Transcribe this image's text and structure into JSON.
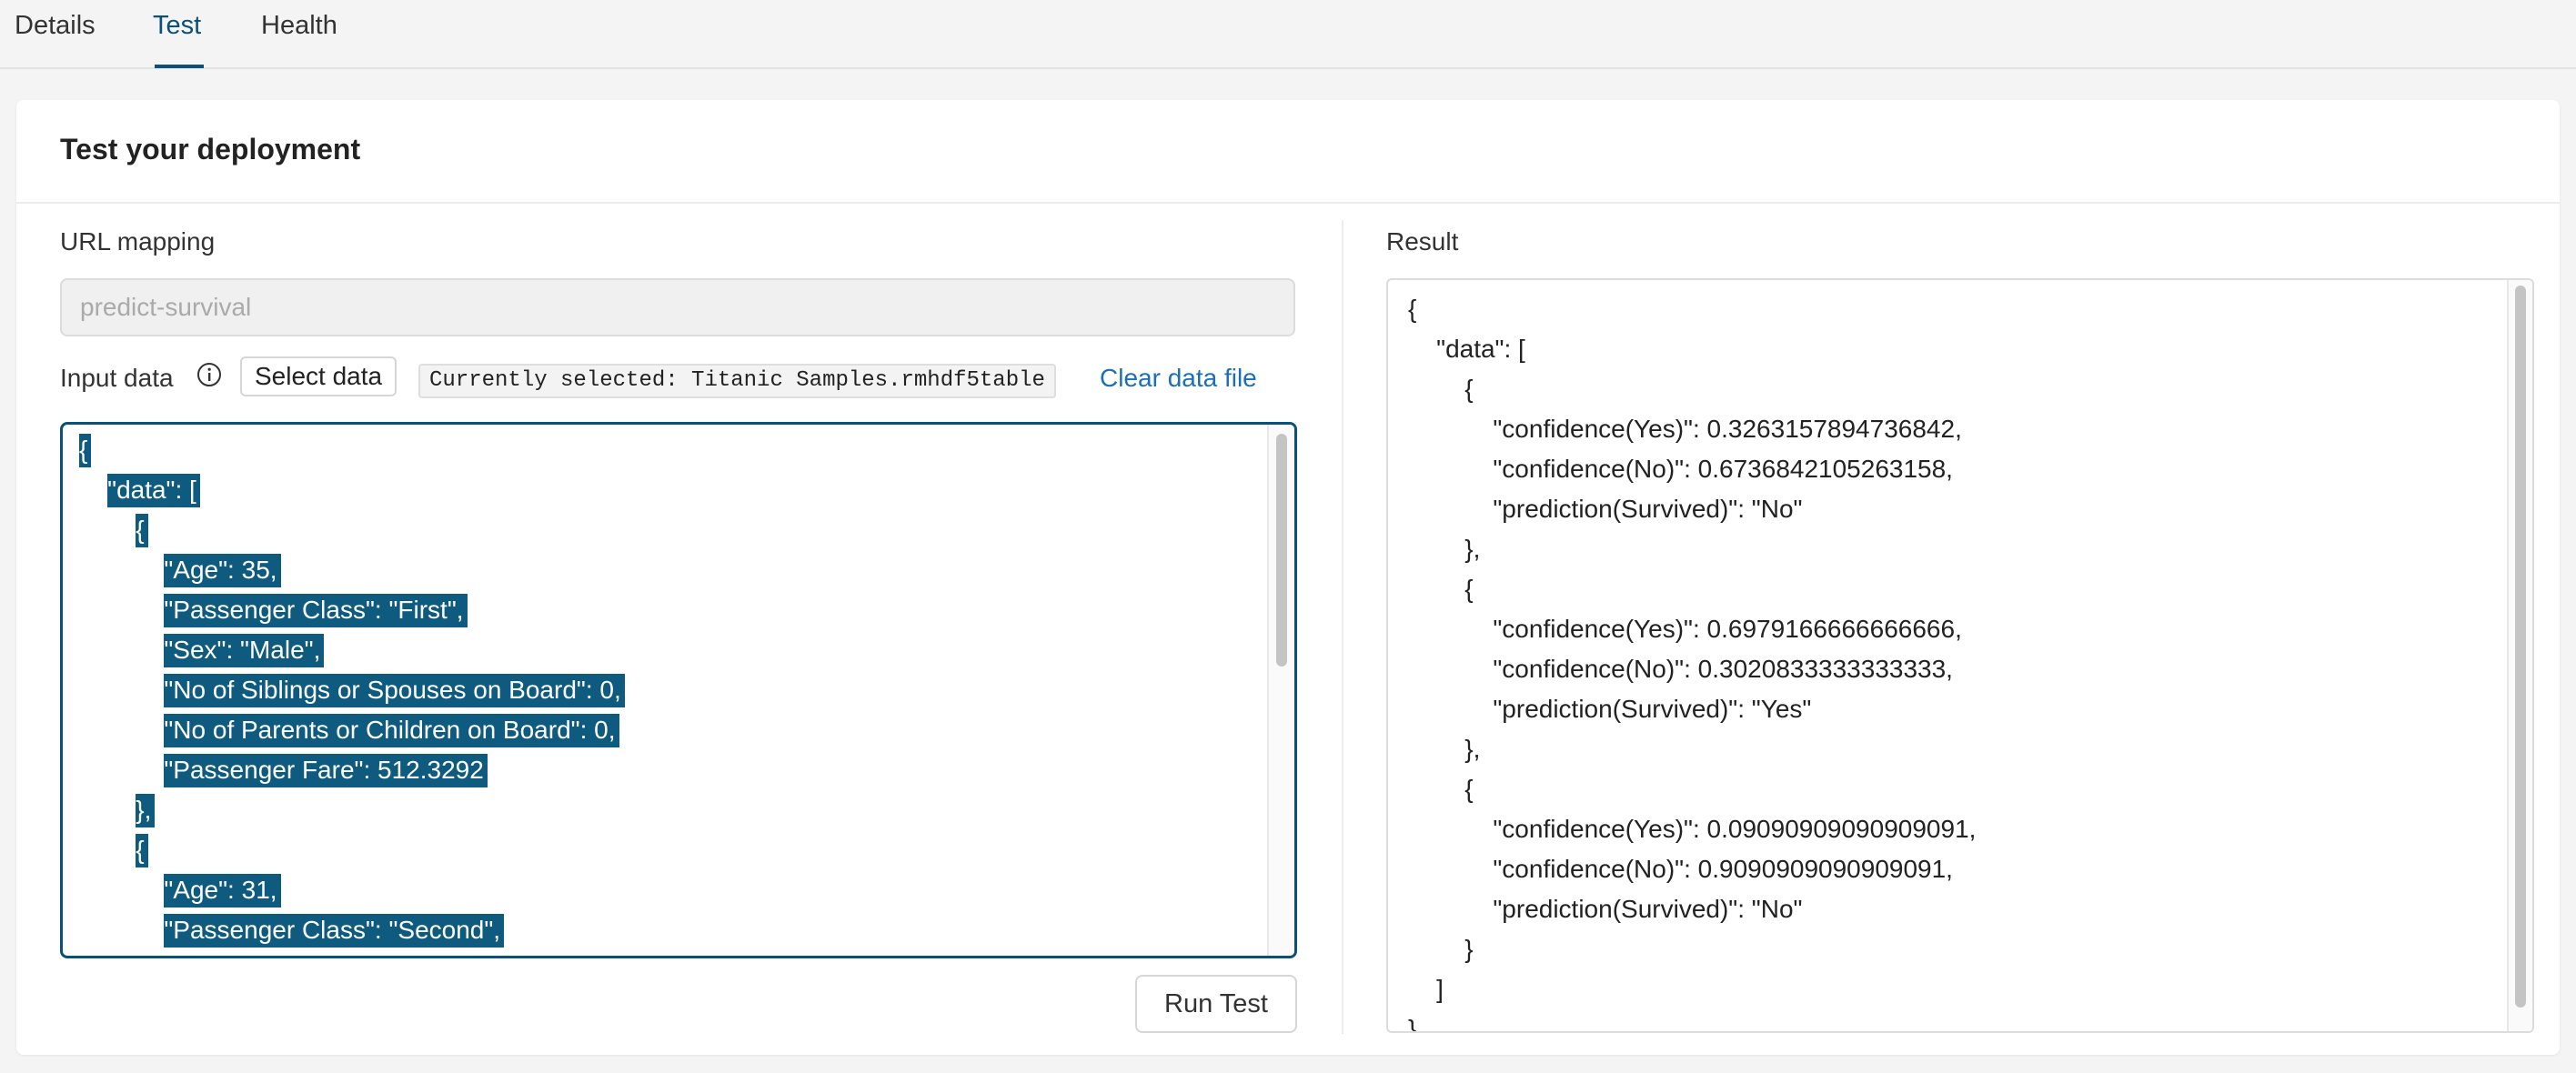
{
  "tabs": {
    "details": "Details",
    "test": "Test",
    "health": "Health"
  },
  "card": {
    "title": "Test your deployment"
  },
  "url_mapping": {
    "label": "URL mapping",
    "placeholder": "predict-survival"
  },
  "input_data": {
    "label": "Input data",
    "select_button": "Select data",
    "currently_selected": "Currently selected: Titanic Samples.rmhdf5table",
    "clear_link": "Clear data file",
    "lines": [
      "{",
      "    \"data\": [",
      "        {",
      "            \"Age\": 35,",
      "            \"Passenger Class\": \"First\",",
      "            \"Sex\": \"Male\",",
      "            \"No of Siblings or Spouses on Board\": 0,",
      "            \"No of Parents or Children on Board\": 0,",
      "            \"Passenger Fare\": 512.3292",
      "        },",
      "        {",
      "            \"Age\": 31,",
      "            \"Passenger Class\": \"Second\","
    ]
  },
  "run_test": "Run Test",
  "result": {
    "label": "Result",
    "lines": [
      "{",
      "    \"data\": [",
      "        {",
      "            \"confidence(Yes)\": 0.3263157894736842,",
      "            \"confidence(No)\": 0.6736842105263158,",
      "            \"prediction(Survived)\": \"No\"",
      "        },",
      "        {",
      "            \"confidence(Yes)\": 0.6979166666666666,",
      "            \"confidence(No)\": 0.3020833333333333,",
      "            \"prediction(Survived)\": \"Yes\"",
      "        },",
      "        {",
      "            \"confidence(Yes)\": 0.09090909090909091,",
      "            \"confidence(No)\": 0.9090909090909091,",
      "            \"prediction(Survived)\": \"No\"",
      "        }",
      "    ]",
      "}"
    ]
  },
  "colors": {
    "accent": "#0a5078",
    "selection": "#0f5b80",
    "link": "#1b6fb8"
  }
}
